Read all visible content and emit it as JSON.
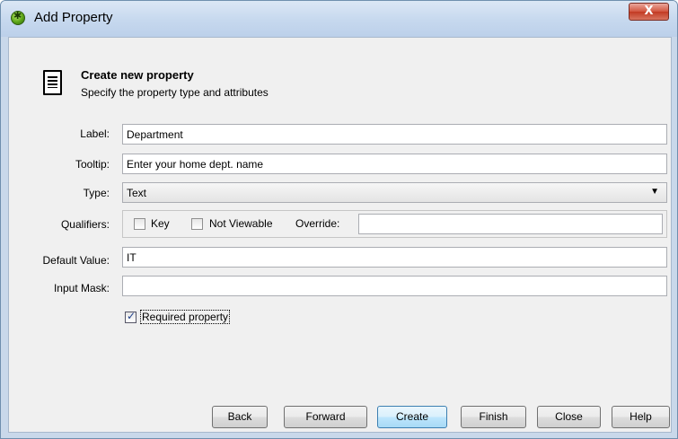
{
  "window": {
    "title": "Add Property",
    "close_symbol": "X"
  },
  "header": {
    "title": "Create new property",
    "subtitle": "Specify the property type and attributes"
  },
  "form": {
    "label": {
      "label": "Label:",
      "value": "Department"
    },
    "tooltip": {
      "label": "Tooltip:",
      "value": "Enter your home dept. name"
    },
    "type": {
      "label": "Type:",
      "value": "Text",
      "arrow": "▼"
    },
    "qualifiers": {
      "label": "Qualifiers:",
      "key": {
        "label": "Key",
        "checked": false
      },
      "not_viewable": {
        "label": "Not Viewable",
        "checked": false
      },
      "override": {
        "label": "Override:",
        "value": ""
      }
    },
    "default_value": {
      "label": "Default Value:",
      "value": "IT"
    },
    "input_mask": {
      "label": "Input Mask:",
      "value": ""
    },
    "required": {
      "label": "Required property",
      "checked": true
    }
  },
  "buttons": {
    "back": "Back",
    "forward": "Forward",
    "create": "Create",
    "finish": "Finish",
    "close": "Close",
    "help": "Help"
  }
}
